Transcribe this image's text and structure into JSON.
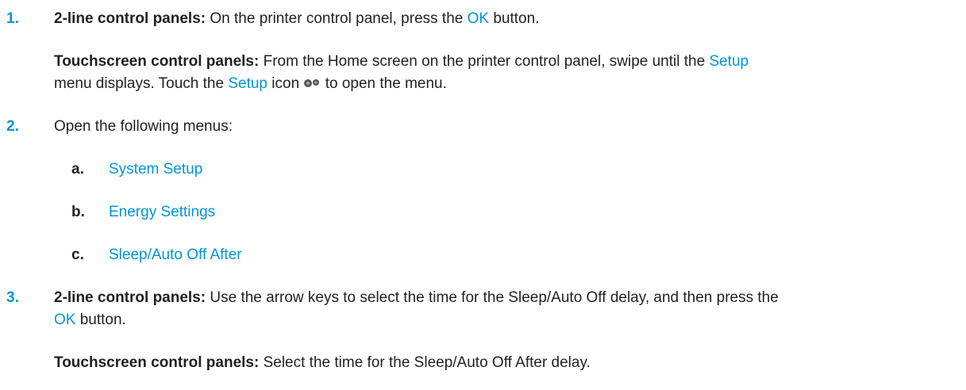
{
  "steps": {
    "s1": {
      "num": "1.",
      "p1": {
        "label": "2-line control panels:",
        "t1": " On the printer control panel, press the ",
        "link_ok": "OK",
        "t2": " button."
      },
      "p2": {
        "label": "Touchscreen control panels:",
        "t1": " From the Home screen on the printer control panel, swipe until the ",
        "link_setup": "Setup",
        "line2_t1": "menu displays. Touch the ",
        "link_setup2": "Setup",
        "line2_t2": " icon ",
        "line2_t3": " to open the menu."
      }
    },
    "s2": {
      "num": "2.",
      "text": "Open the following menus:",
      "subs": [
        {
          "letter": "a.",
          "text": "System Setup"
        },
        {
          "letter": "b.",
          "text": "Energy Settings"
        },
        {
          "letter": "c.",
          "text": "Sleep/Auto Off After"
        }
      ]
    },
    "s3": {
      "num": "3.",
      "p1": {
        "label": "2-line control panels:",
        "t1": " Use the arrow keys to select the time for the Sleep/Auto Off delay, and then press the",
        "link_ok": "OK",
        "t2": " button."
      },
      "p2": {
        "label": "Touchscreen control panels:",
        "t1": " Select the time for the Sleep/Auto Off After delay."
      }
    }
  },
  "colors": {
    "accent": "#0096d6",
    "text": "#231f20"
  },
  "icons": {
    "setup": "gears-icon"
  }
}
